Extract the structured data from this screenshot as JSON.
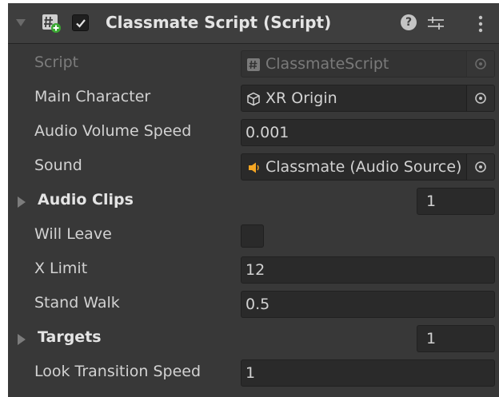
{
  "component": {
    "title": "Classmate Script (Script)",
    "enabled": true,
    "icons": {
      "foldout": "foldout-arrow-down-icon",
      "script": "csharp-script-icon",
      "help": "help-icon",
      "presets": "presets-icon",
      "menu": "kebab-menu-icon"
    },
    "help_glyph": "?"
  },
  "fields": {
    "script": {
      "label": "Script",
      "value": "ClassmateScript",
      "icon": "script-file-icon"
    },
    "main_character": {
      "label": "Main Character",
      "value": "XR Origin",
      "icon": "gameobject-cube-icon"
    },
    "audio_volume_speed": {
      "label": "Audio Volume Speed",
      "value": "0.001"
    },
    "sound": {
      "label": "Sound",
      "value": "Classmate (Audio Source)",
      "icon": "audio-source-icon"
    },
    "audio_clips": {
      "label": "Audio Clips",
      "count": "1"
    },
    "will_leave": {
      "label": "Will Leave",
      "checked": false
    },
    "x_limit": {
      "label": "X Limit",
      "value": "12"
    },
    "stand_walk": {
      "label": "Stand Walk",
      "value": "0.5"
    },
    "targets": {
      "label": "Targets",
      "count": "1"
    },
    "look_transition_speed": {
      "label": "Look Transition Speed",
      "value": "1"
    }
  },
  "colors": {
    "panel_bg": "#383838",
    "header_bg": "#3e3e3e",
    "field_bg": "#2a2a2a",
    "audio_icon": "#f5a623",
    "script_icon": "#8a8a8a"
  }
}
